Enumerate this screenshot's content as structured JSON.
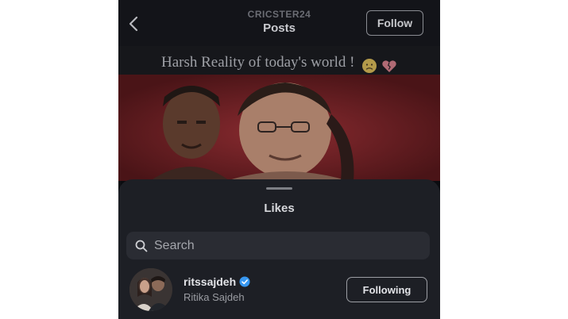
{
  "header": {
    "account_name": "CRICSTER24",
    "title": "Posts",
    "follow_label": "Follow"
  },
  "post": {
    "caption": "Harsh Reality of today's world !",
    "emojis": [
      "sad-face-emoji",
      "broken-heart-emoji"
    ]
  },
  "likes_sheet": {
    "title": "Likes",
    "search_placeholder": "Search",
    "users": [
      {
        "username": "ritssajdeh",
        "full_name": "Ritika Sajdeh",
        "verified": true,
        "button_label": "Following"
      }
    ]
  },
  "icons": {
    "back": "chevron-left-icon",
    "search": "search-icon",
    "verified": "verified-badge-icon"
  },
  "colors": {
    "background": "#0b0c10",
    "sheet": "#1d1f25",
    "verified_blue": "#3797f0",
    "post_red": "#6b2126"
  }
}
